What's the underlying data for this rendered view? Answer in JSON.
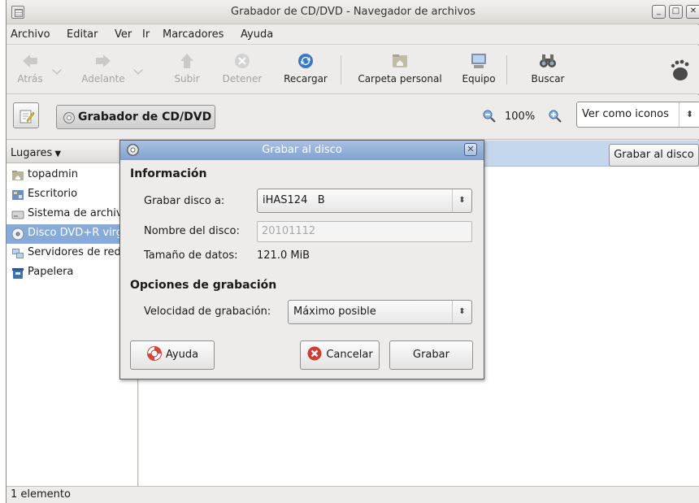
{
  "window": {
    "title": "Grabador de CD/DVD - Navegador de archivos",
    "buttons": [
      "minimize",
      "maximize",
      "close"
    ]
  },
  "menubar": {
    "items": [
      "Archivo",
      "Editar",
      "Ver",
      "Ir",
      "Marcadores",
      "Ayuda"
    ]
  },
  "toolbar": {
    "back": "Atrás",
    "forward": "Adelante",
    "up": "Subir",
    "stop": "Detener",
    "reload": "Recargar",
    "home": "Carpeta personal",
    "computer": "Equipo",
    "search": "Buscar"
  },
  "locationbar": {
    "path_button": "Grabador de CD/DVD",
    "zoom": "100%",
    "view_mode": "Ver como iconos"
  },
  "sidebar": {
    "header": "Lugares",
    "items": [
      {
        "label": "topadmin",
        "icon": "folder-home-icon"
      },
      {
        "label": "Escritorio",
        "icon": "desktop-icon"
      },
      {
        "label": "Sistema de archivos",
        "icon": "drive-icon"
      },
      {
        "label": "Disco DVD+R virgen",
        "icon": "optical-disc-icon"
      },
      {
        "label": "Servidores de red",
        "icon": "network-icon"
      },
      {
        "label": "Papelera",
        "icon": "trash-icon"
      }
    ],
    "selected_index": 3
  },
  "content": {
    "burn_button": "Grabar al disco"
  },
  "statusbar": {
    "text": "1 elemento"
  },
  "dialog": {
    "title": "Grabar al disco",
    "section_info": "Información",
    "burn_to_label": "Grabar disco a:",
    "burn_to_value": "iHAS124   B",
    "disc_name_label": "Nombre del disco:",
    "disc_name_value": "20101112",
    "data_size_label": "Tamaño de datos:",
    "data_size_value": "121.0 MiB",
    "section_options": "Opciones de grabación",
    "speed_label": "Velocidad de grabación:",
    "speed_value": "Máximo posible",
    "help_button": "Ayuda",
    "cancel_button": "Cancelar",
    "burn_button": "Grabar"
  },
  "colors": {
    "selection": "#86abd9",
    "dialog_title": "#7fa2cf",
    "infobar": "#c5d7ec"
  }
}
